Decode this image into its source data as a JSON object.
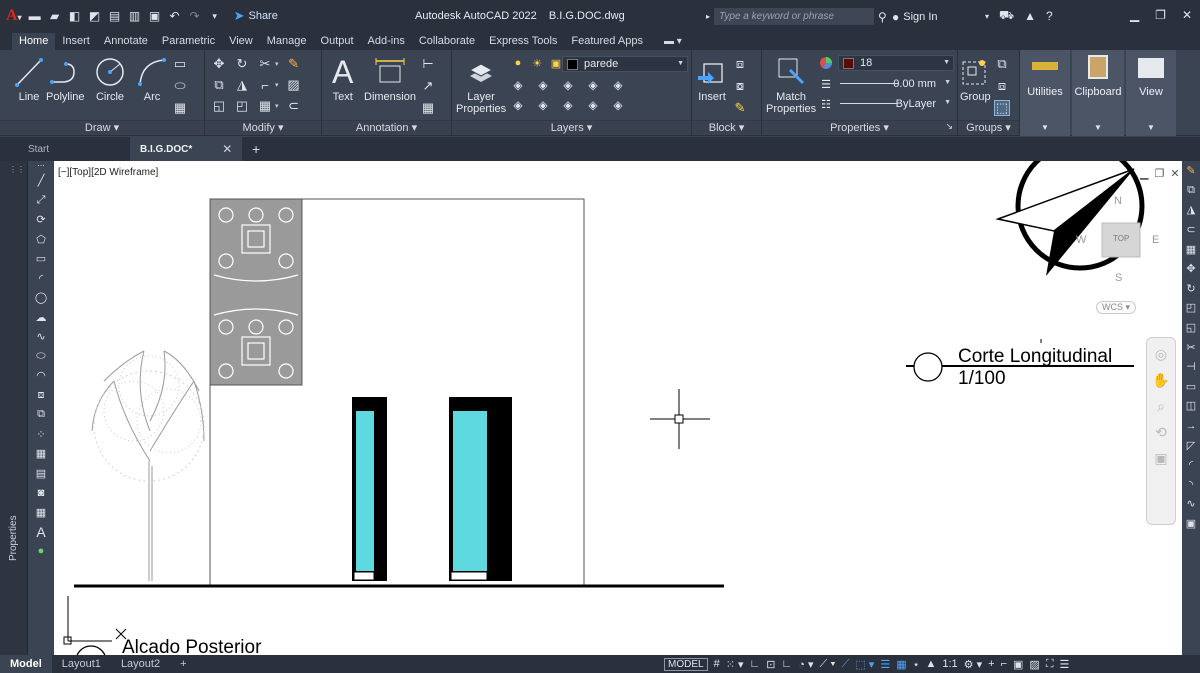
{
  "title_bar": {
    "app_icon": "autocad-a-logo",
    "quick_access": [
      "new-icon",
      "open-icon",
      "save-icon",
      "save-as-icon",
      "web-open-icon",
      "web-save-icon",
      "print-icon",
      "undo-icon",
      "redo-icon"
    ],
    "share_label": "Share",
    "document_title": "Autodesk AutoCAD 2022    B.I.G.DOC.dwg",
    "search_placeholder": "Type a keyword or phrase",
    "signin_label": "Sign In"
  },
  "ribbon_tabs": [
    "Home",
    "Insert",
    "Annotate",
    "Parametric",
    "View",
    "Manage",
    "Output",
    "Add-ins",
    "Collaborate",
    "Express Tools",
    "Featured Apps"
  ],
  "active_tab": "Home",
  "ribbon": {
    "draw": {
      "label": "Draw",
      "tools": [
        "Line",
        "Polyline",
        "Circle",
        "Arc"
      ]
    },
    "modify": {
      "label": "Modify"
    },
    "annotation": {
      "label": "Annotation",
      "tools": [
        "Text",
        "Dimension"
      ]
    },
    "layers": {
      "label": "Layers",
      "tool": [
        "Layer",
        "Properties"
      ],
      "current_layer": "parede"
    },
    "block": {
      "label": "Block",
      "tool": "Insert"
    },
    "properties": {
      "label": "Properties",
      "tool": [
        "Match",
        "Properties"
      ],
      "color_value": "18",
      "lineweight": "0.00 mm",
      "linetype": "ByLayer"
    },
    "groups": {
      "label": "Groups",
      "tool": "Group"
    },
    "utilities": {
      "label": "Utilities"
    },
    "clipboard": {
      "label": "Clipboard"
    },
    "view": {
      "label": "View"
    }
  },
  "file_tabs": {
    "start": "Start",
    "active": "B.I.G.DOC*"
  },
  "properties_palette_label": "Properties",
  "viewport": {
    "label": "[−][Top][2D Wireframe]",
    "wcs": "WCS",
    "viewcube": {
      "top": "TOP",
      "north": "N",
      "south": "S",
      "east": "E",
      "west": "W"
    }
  },
  "drawing_labels": {
    "section_title": "Corte Longitudinal",
    "section_scale": "1/100",
    "elevation_title": "Alcado Posterior"
  },
  "colors": {
    "canvas": "#ffffff",
    "window_glass": "#5ed9e0",
    "ribbon": "#3b4453",
    "title": "#2b313c",
    "accent": "#4aa3ff"
  },
  "status_bar": {
    "layouts": [
      "Model",
      "Layout1",
      "Layout2"
    ],
    "space": "MODEL",
    "annotation_scale": "1:1"
  }
}
